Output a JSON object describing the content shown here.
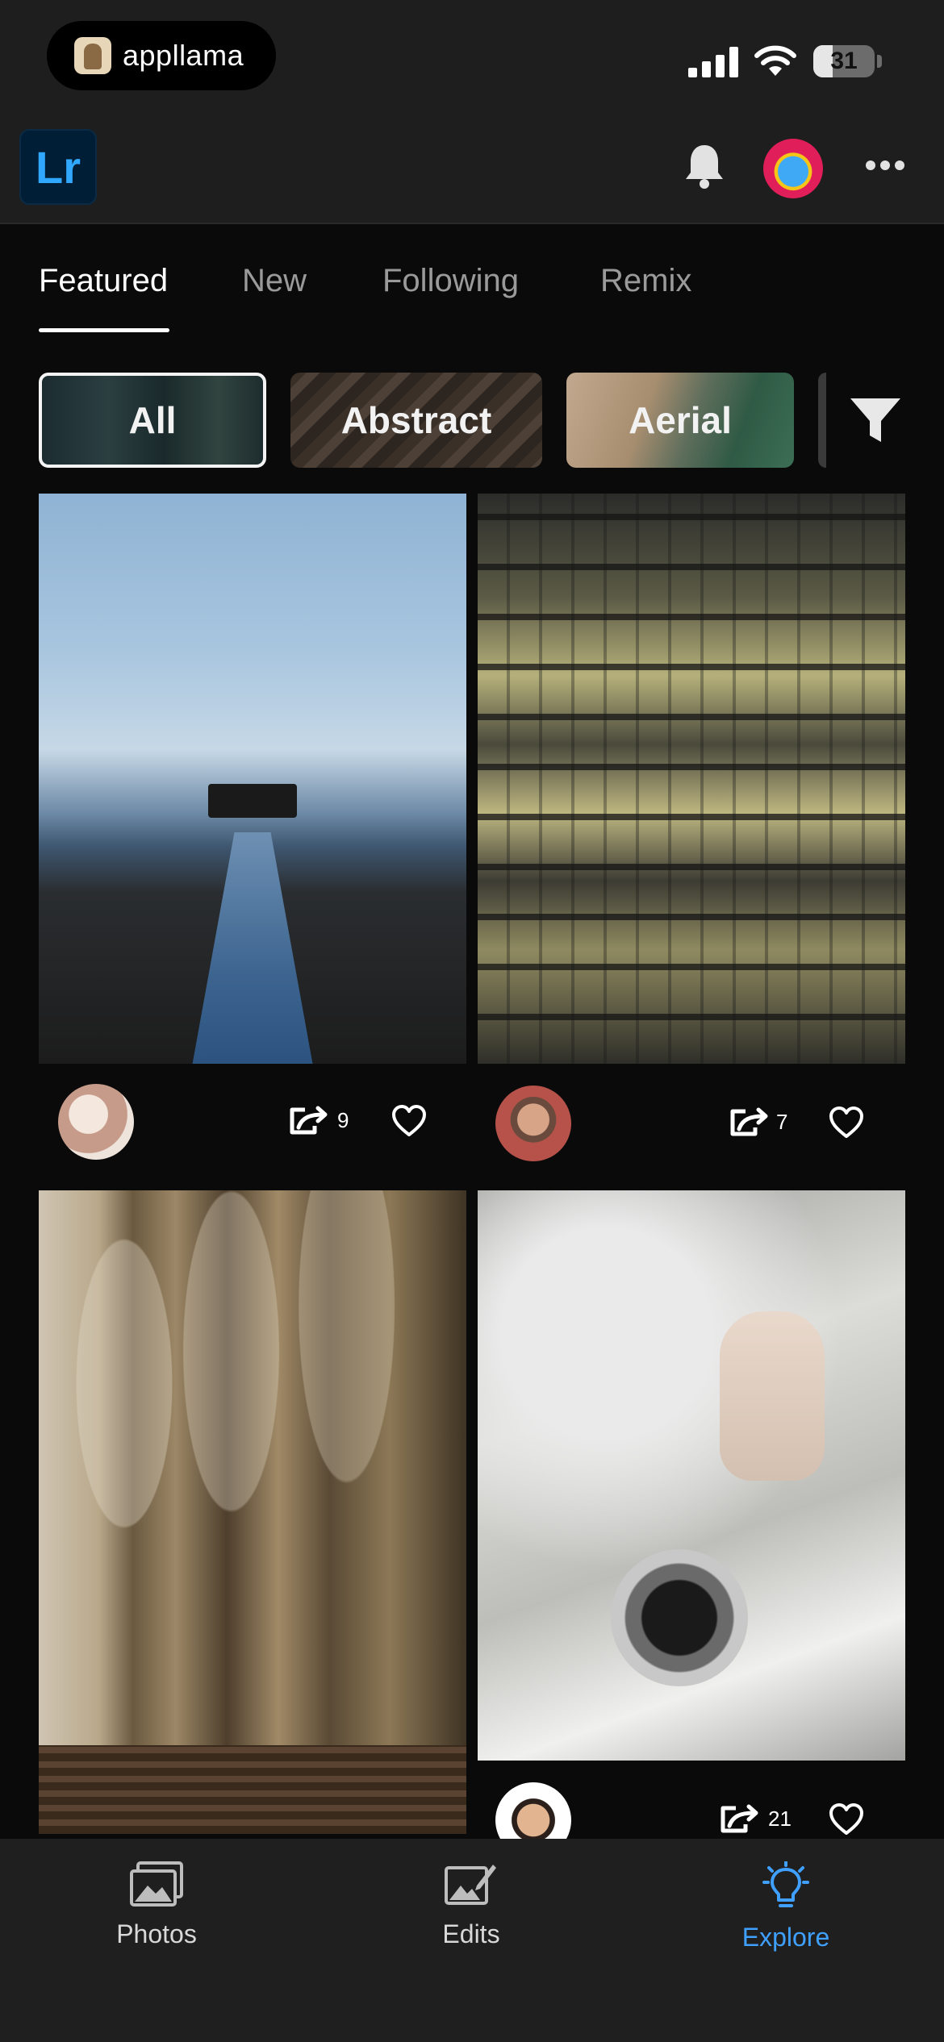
{
  "status_bar": {
    "carrier_app": "appllama",
    "battery_level": "31",
    "battery_fraction": 0.31
  },
  "header": {
    "app_logo": "Lr"
  },
  "tabs": [
    {
      "label": "Featured",
      "active": true
    },
    {
      "label": "New",
      "active": false
    },
    {
      "label": "Following",
      "active": false
    },
    {
      "label": "Remix",
      "active": false
    }
  ],
  "chips": [
    {
      "label": "All",
      "selected": true
    },
    {
      "label": "Abstract",
      "selected": false
    },
    {
      "label": "Aerial",
      "selected": false
    }
  ],
  "cards": [
    {
      "remix_count": "9"
    },
    {
      "remix_count": "7"
    },
    {
      "remix_count": ""
    },
    {
      "remix_count": "21"
    }
  ],
  "bottom_nav": [
    {
      "label": "Photos",
      "icon": "photos-icon",
      "active": false
    },
    {
      "label": "Edits",
      "icon": "edits-icon",
      "active": false
    },
    {
      "label": "Explore",
      "icon": "lightbulb-icon",
      "active": true
    }
  ],
  "colors": {
    "accent": "#3fa0ff",
    "lr_brand": "#31a8ff",
    "background": "#0a0a0a",
    "bar_background": "#1e1e1e"
  }
}
